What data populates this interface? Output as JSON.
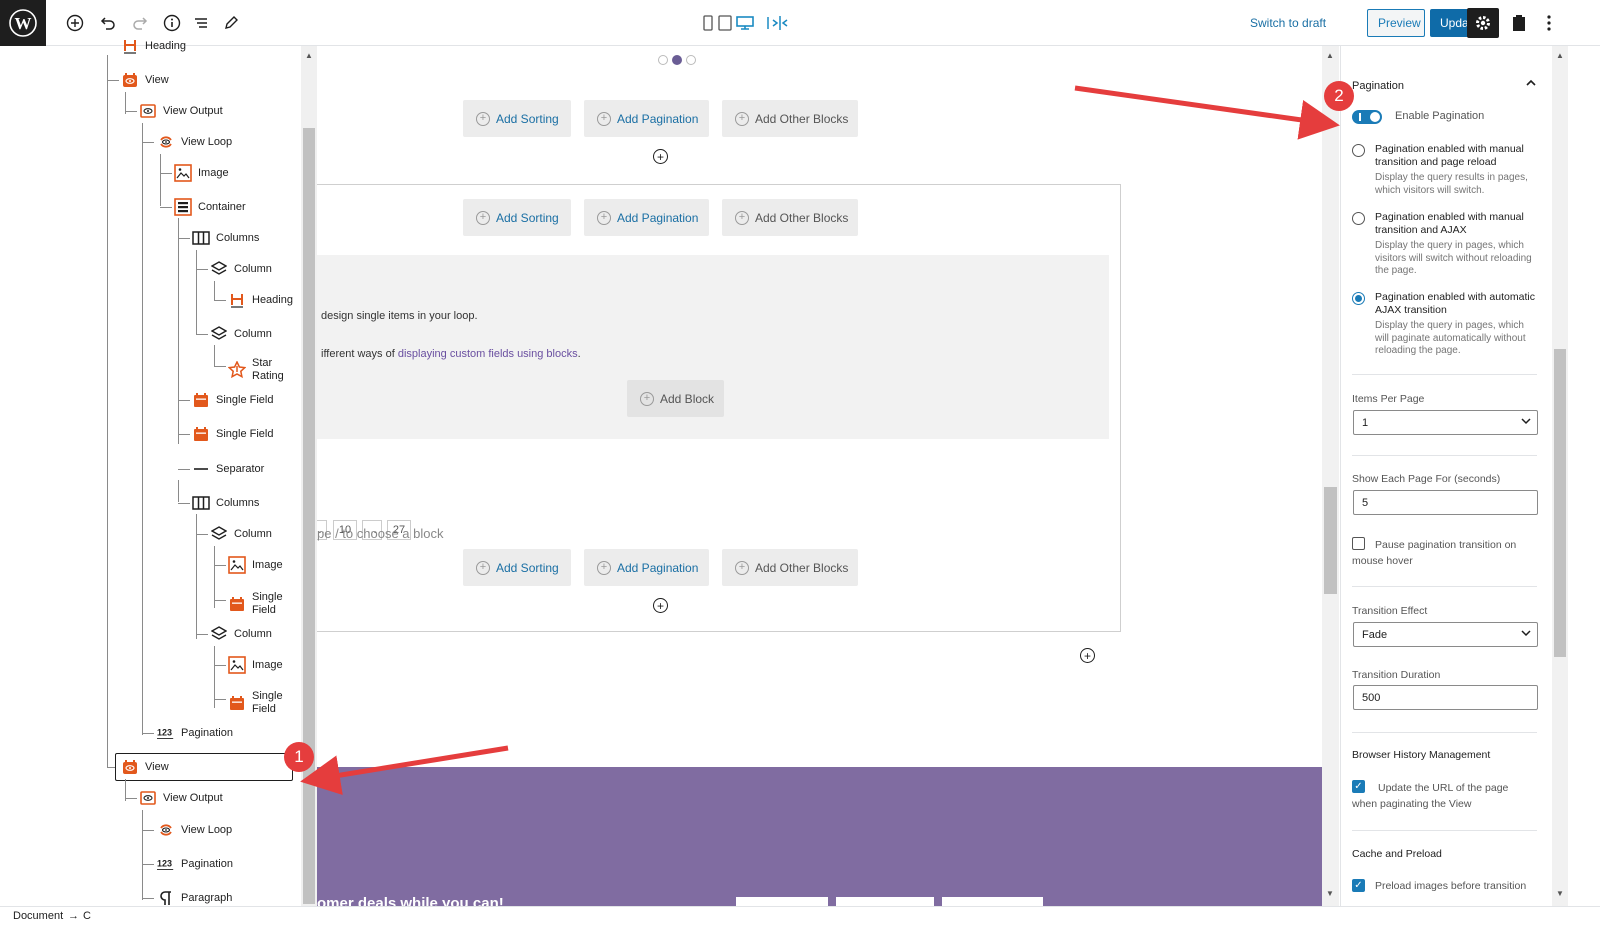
{
  "toolbar": {
    "switch_to_draft": "Switch to draft",
    "preview": "Preview",
    "update": "Update"
  },
  "list_view": {
    "items": [
      {
        "label": "Heading",
        "icon": "heading-icon"
      },
      {
        "label": "View",
        "icon": "view-icon"
      },
      {
        "label": "View Output",
        "icon": "view-output-icon"
      },
      {
        "label": "View Loop",
        "icon": "view-loop-icon"
      },
      {
        "label": "Image",
        "icon": "image-icon"
      },
      {
        "label": "Container",
        "icon": "container-icon"
      },
      {
        "label": "Columns",
        "icon": "columns-icon"
      },
      {
        "label": "Column",
        "icon": "column-icon"
      },
      {
        "label": "Heading",
        "icon": "heading-icon"
      },
      {
        "label": "Column",
        "icon": "column-icon"
      },
      {
        "label": "Star",
        "label2": "Rating",
        "icon": "star-rating-icon"
      },
      {
        "label": "Single Field",
        "icon": "single-field-icon"
      },
      {
        "label": "Single Field",
        "icon": "single-field-icon"
      },
      {
        "label": "Separator",
        "icon": "separator-icon"
      },
      {
        "label": "Columns",
        "icon": "columns-icon"
      },
      {
        "label": "Column",
        "icon": "column-icon"
      },
      {
        "label": "Image",
        "icon": "image-icon"
      },
      {
        "label": "Single",
        "label2": "Field",
        "icon": "single-field-icon"
      },
      {
        "label": "Column",
        "icon": "column-icon"
      },
      {
        "label": "Image",
        "icon": "image-icon"
      },
      {
        "label": "Single",
        "label2": "Field",
        "icon": "single-field-icon"
      },
      {
        "label": "Pagination",
        "icon": "pagination-icon"
      },
      {
        "label": "View",
        "icon": "view-icon"
      },
      {
        "label": "View Output",
        "icon": "view-output-icon"
      },
      {
        "label": "View Loop",
        "icon": "view-loop-icon"
      },
      {
        "label": "Pagination",
        "icon": "pagination-icon"
      },
      {
        "label": "Paragraph",
        "icon": "paragraph-icon"
      }
    ]
  },
  "canvas": {
    "add_sorting": "Add Sorting",
    "add_pagination": "Add Pagination",
    "add_other_blocks": "Add Other Blocks",
    "add_block": "Add Block",
    "text_line1": "design single items in your loop.",
    "text_line2_prefix": "ifferent ways of ",
    "text_line2_link": "displaying custom fields using blocks",
    "text_line2_suffix": ".",
    "pagination_pages": [
      "..",
      "10",
      "...",
      "27"
    ],
    "block_hint": "pe / to choose a block",
    "banner_text": "omer deals while you can!",
    "banner_color": "#806ca1"
  },
  "settings": {
    "panel_title": "Pagination",
    "enable_pagination": "Enable Pagination",
    "options": [
      {
        "title": "Pagination enabled with manual transition and page reload",
        "desc": "Display the query results in pages, which visitors will switch.",
        "checked": false
      },
      {
        "title": "Pagination enabled with manual transition and AJAX",
        "desc": "Display the query in pages, which visitors will switch without reloading the page.",
        "checked": false
      },
      {
        "title": "Pagination enabled with automatic AJAX transition",
        "desc": "Display the query in pages, which will paginate automatically without reloading the page.",
        "checked": true
      }
    ],
    "items_per_page_label": "Items Per Page",
    "items_per_page_value": "1",
    "show_each_page_label": "Show Each Page For (seconds)",
    "show_each_page_value": "5",
    "pause_label": "Pause pagination transition on mouse hover",
    "transition_effect_label": "Transition Effect",
    "transition_effect_value": "Fade",
    "transition_duration_label": "Transition Duration",
    "transition_duration_value": "500",
    "browser_history_title": "Browser History Management",
    "update_url_label": "Update the URL of the page when paginating the View",
    "cache_title": "Cache and Preload",
    "preload_label": "Preload images before transition"
  },
  "footer": {
    "breadcrumb": "Document",
    "arrow": "→",
    "tail": "C"
  },
  "annotations": {
    "badge1": "1",
    "badge2": "2"
  },
  "colors": {
    "accent": "#1a7bb7",
    "icon_orange": "#e2581c",
    "annotation_red": "#e53d3d"
  }
}
